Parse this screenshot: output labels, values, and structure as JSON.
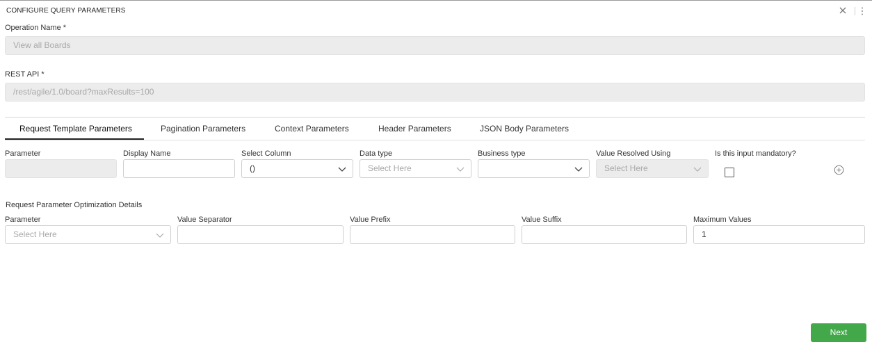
{
  "dialog": {
    "title": "CONFIGURE QUERY PARAMETERS",
    "icons": [
      "close-icon",
      "more-vertical-icon"
    ]
  },
  "operation": {
    "label": "Operation Name *",
    "value": "View all Boards"
  },
  "rest_api": {
    "label": "REST API *",
    "value": "/rest/agile/1.0/board?maxResults=100"
  },
  "tabs": [
    {
      "label": "Request Template Parameters",
      "active": true
    },
    {
      "label": "Pagination Parameters",
      "active": false
    },
    {
      "label": "Context Parameters",
      "active": false
    },
    {
      "label": "Header Parameters",
      "active": false
    },
    {
      "label": "JSON Body Parameters",
      "active": false
    }
  ],
  "request_template": {
    "parameter": {
      "label": "Parameter",
      "value": ""
    },
    "display_name": {
      "label": "Display Name",
      "value": ""
    },
    "select_column": {
      "label": "Select Column",
      "value": "()"
    },
    "data_type": {
      "label": "Data type",
      "placeholder": "Select Here"
    },
    "business_type": {
      "label": "Business type",
      "value": ""
    },
    "value_resolved_using": {
      "label": "Value Resolved Using",
      "placeholder": "Select Here"
    },
    "mandatory": {
      "label": "Is this input mandatory?",
      "checked": false
    }
  },
  "optimization": {
    "title": "Request Parameter Optimization Details",
    "parameter": {
      "label": "Parameter",
      "placeholder": "Select Here"
    },
    "value_separator": {
      "label": "Value Separator",
      "value": ""
    },
    "value_prefix": {
      "label": "Value Prefix",
      "value": ""
    },
    "value_suffix": {
      "label": "Value Suffix",
      "value": ""
    },
    "maximum_values": {
      "label": "Maximum Values",
      "value": "1"
    }
  },
  "footer": {
    "next_label": "Next"
  },
  "colors": {
    "accent_green": "#43a84a",
    "disabled_bg": "#ececec",
    "border": "#cfcfcf"
  }
}
